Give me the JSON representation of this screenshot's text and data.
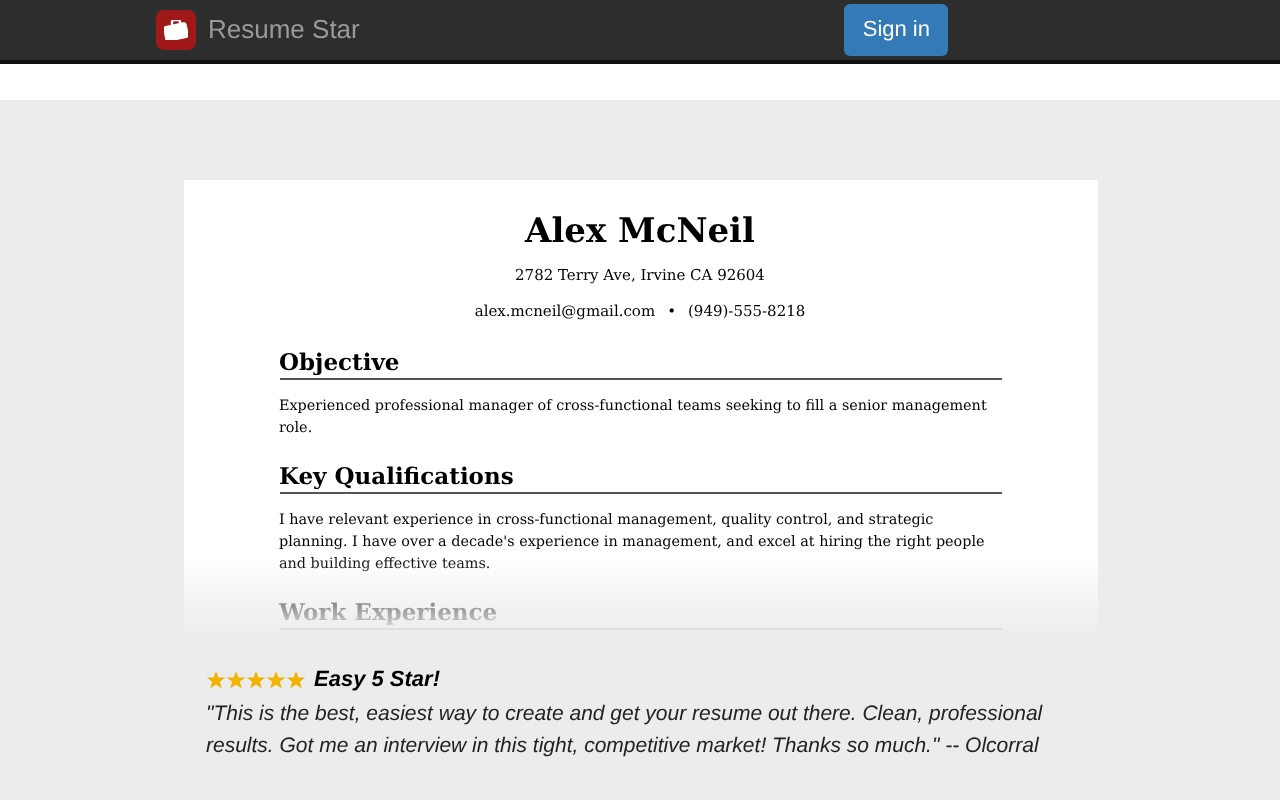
{
  "navbar": {
    "brand": "Resume Star",
    "sign_in": "Sign in"
  },
  "resume": {
    "name": "Alex McNeil",
    "address": "2782 Terry Ave, Irvine CA 92604",
    "email": "alex.mcneil@gmail.com",
    "separator": "•",
    "phone": "(949)-555-8218",
    "sections": [
      {
        "heading": "Objective",
        "text": "Experienced professional manager of cross-functional teams seeking to fill a senior management role."
      },
      {
        "heading": "Key Qualifications",
        "text": "I have relevant experience in cross-functional management, quality control, and strategic planning. I have over a decade's experience in management, and excel at hiring the right people and building effective teams."
      },
      {
        "heading": "Work Experience"
      }
    ]
  },
  "review": {
    "stars": 5,
    "title": "Easy 5 Star!",
    "quote": "\"This is the best, easiest way to create and get your resume out there. Clean, professional results. Got me an interview in this tight, competitive market! Thanks so much.\" -- Olcorral"
  }
}
